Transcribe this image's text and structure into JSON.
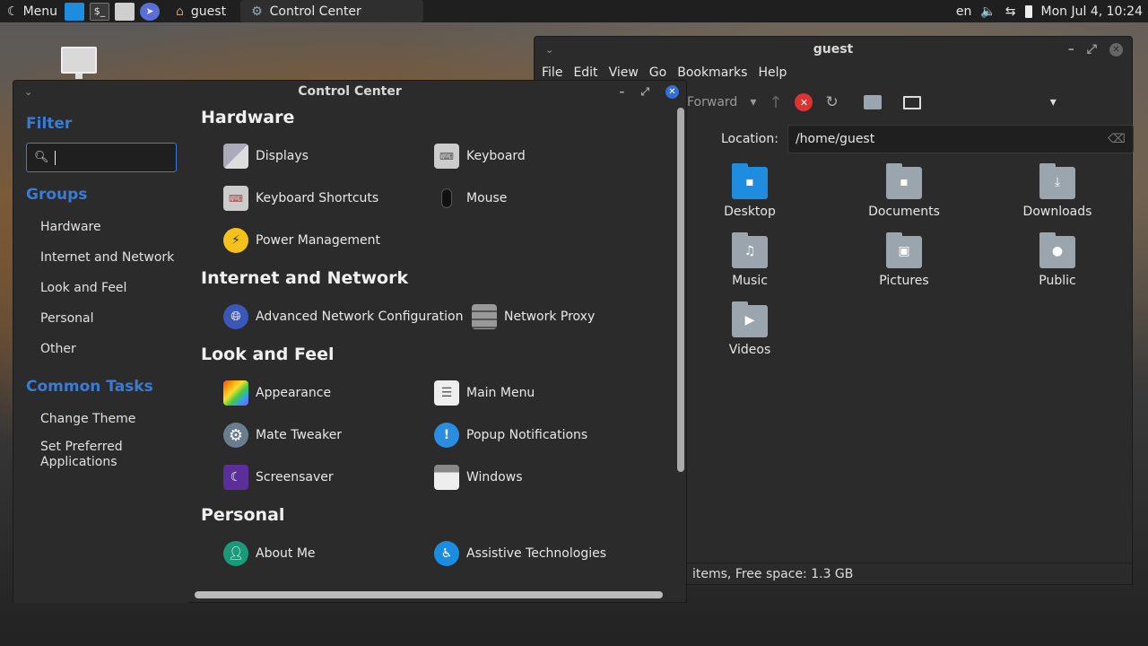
{
  "panel": {
    "menu_label": "Menu",
    "task_home": "guest",
    "task_active": "Control Center",
    "keyboard_layout": "en",
    "clock": "Mon Jul  4, 10:24"
  },
  "file_manager": {
    "title": "guest",
    "menu": [
      "File",
      "Edit",
      "View",
      "Go",
      "Bookmarks",
      "Help"
    ],
    "forward_label": "Forward",
    "location_label": "Location:",
    "location_value": "/home/guest",
    "items": [
      {
        "label": "Desktop",
        "glyph": "▪"
      },
      {
        "label": "Documents",
        "glyph": "▪"
      },
      {
        "label": "Downloads",
        "glyph": "⤓"
      },
      {
        "label": "Music",
        "glyph": "♫"
      },
      {
        "label": "Pictures",
        "glyph": "▣"
      },
      {
        "label": "Public",
        "glyph": "●"
      },
      {
        "label": "Videos",
        "glyph": "▶"
      }
    ],
    "status": "items, Free space: 1.3 GB"
  },
  "control_center": {
    "title": "Control Center",
    "filter_heading": "Filter",
    "groups_heading": "Groups",
    "groups": [
      "Hardware",
      "Internet and Network",
      "Look and Feel",
      "Personal",
      "Other"
    ],
    "common_tasks_heading": "Common Tasks",
    "tasks": [
      "Change Theme",
      "Set Preferred",
      "Applications"
    ],
    "sections": {
      "hardware": "Hardware",
      "internet": "Internet and Network",
      "look": "Look and Feel",
      "personal": "Personal"
    },
    "items": {
      "displays": "Displays",
      "keyboard": "Keyboard",
      "keyboard_shortcuts": "Keyboard Shortcuts",
      "mouse": "Mouse",
      "power": "Power Management",
      "adv_network": "Advanced Network Configuration",
      "network_proxy": "Network Proxy",
      "appearance": "Appearance",
      "main_menu": "Main Menu",
      "mate_tweaker": "Mate Tweaker",
      "popup_notifications": "Popup Notifications",
      "screensaver": "Screensaver",
      "windows": "Windows",
      "about_me": "About Me",
      "assistive": "Assistive Technologies"
    }
  }
}
